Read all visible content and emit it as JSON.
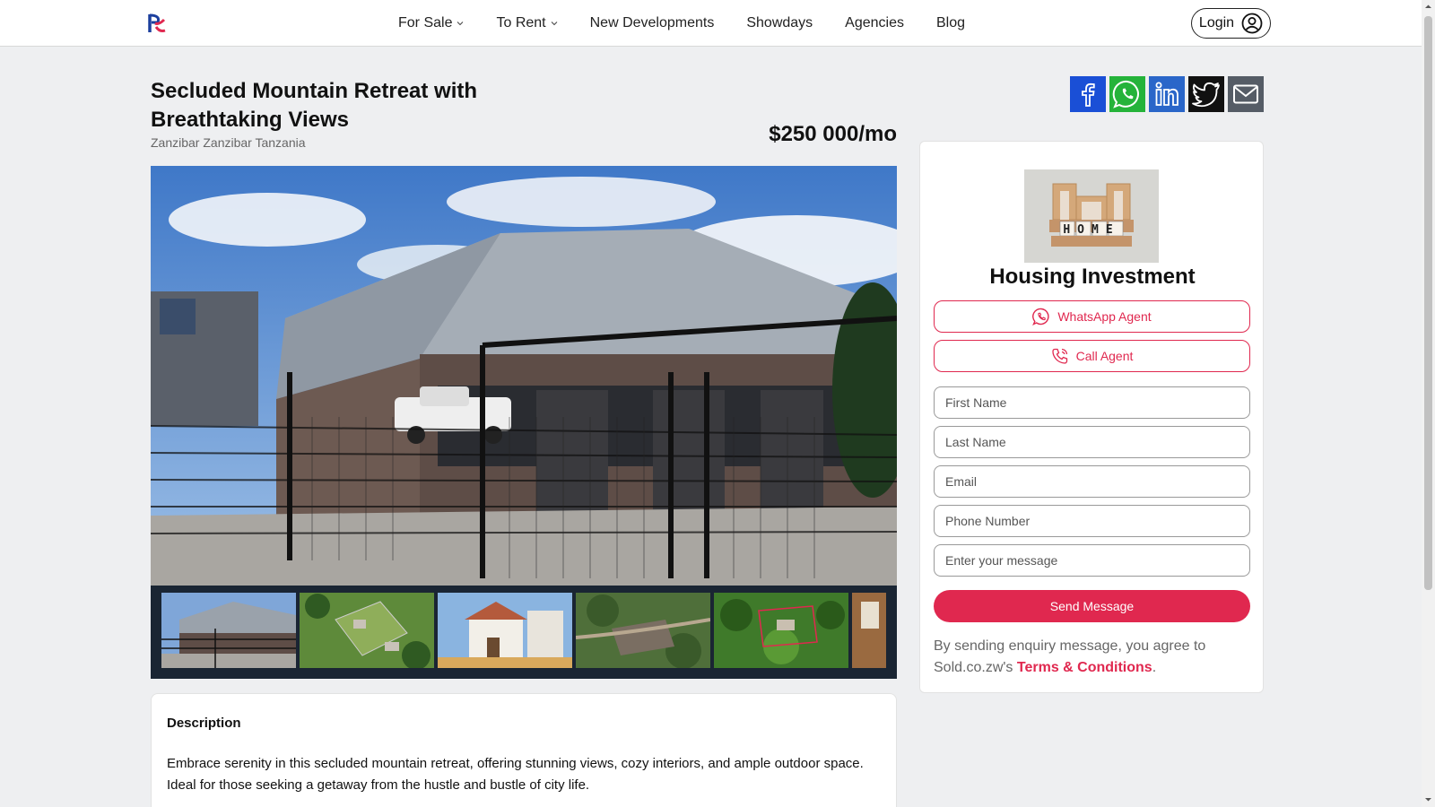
{
  "nav": {
    "items": [
      {
        "label": "For Sale",
        "dropdown": true
      },
      {
        "label": "To Rent",
        "dropdown": true
      },
      {
        "label": "New Developments",
        "dropdown": false
      },
      {
        "label": "Showdays",
        "dropdown": false
      },
      {
        "label": "Agencies",
        "dropdown": false
      },
      {
        "label": "Blog",
        "dropdown": false
      }
    ],
    "login_label": "Login"
  },
  "listing": {
    "title": "Secluded Mountain Retreat with Breathtaking Views",
    "location": "Zanzibar Zanzibar Tanzania",
    "price": "$250 000/mo"
  },
  "share": {
    "icons": [
      "facebook-icon",
      "whatsapp-icon",
      "linkedin-icon",
      "twitter-icon",
      "email-icon"
    ]
  },
  "agent": {
    "logo_text": "HOME",
    "name": "Housing Investment",
    "whatsapp_label": "WhatsApp Agent",
    "call_label": "Call Agent"
  },
  "form": {
    "first_name_placeholder": "First Name",
    "last_name_placeholder": "Last Name",
    "email_placeholder": "Email",
    "phone_placeholder": "Phone Number",
    "message_placeholder": "Enter your message",
    "send_label": "Send Message",
    "agree_prefix": "By sending enquiry message, you agree to Sold.co.zw's ",
    "agree_link": "Terms & Conditions",
    "agree_suffix": "."
  },
  "description": {
    "heading": "Description",
    "text": "Embrace serenity in this secluded mountain retreat, offering stunning views, cozy interiors, and ample outdoor space. Ideal for those seeking a getaway from the hustle and bustle of city life."
  },
  "colors": {
    "accent": "#e0284f",
    "facebook": "#1a4fd6",
    "whatsapp": "#25b33a",
    "linkedin": "#2a66c9",
    "twitter": "#111111",
    "email": "#555c66"
  }
}
